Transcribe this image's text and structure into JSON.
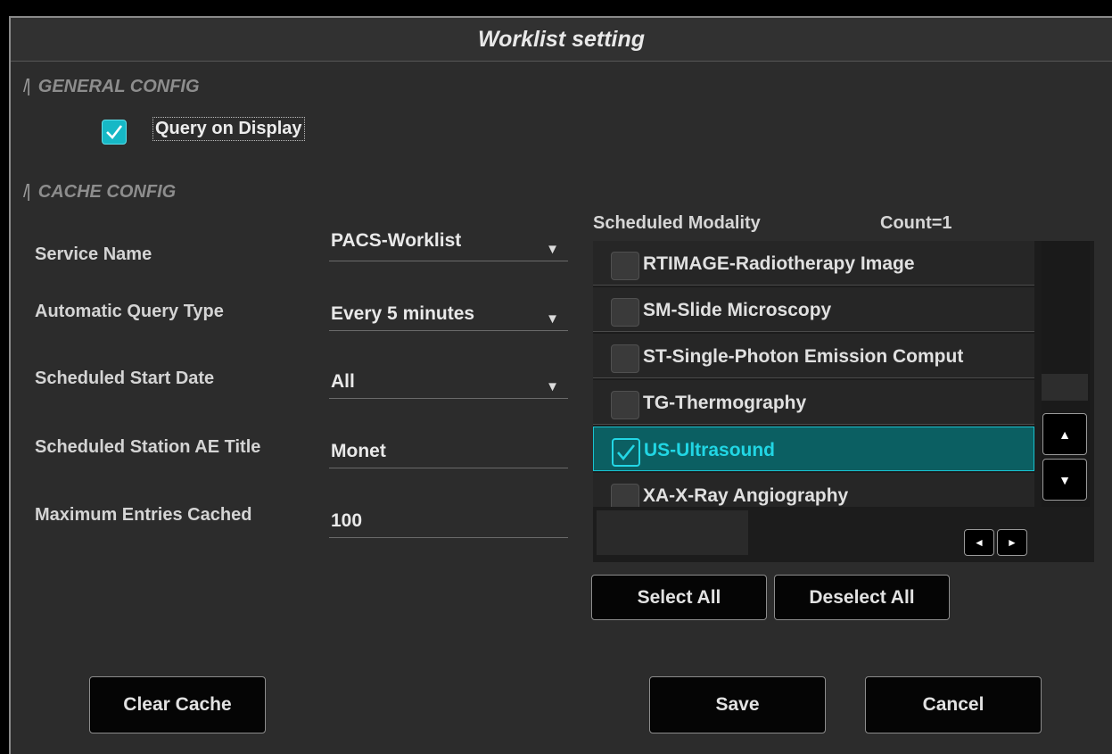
{
  "dialog": {
    "title": "Worklist setting"
  },
  "general": {
    "heading": "GENERAL CONFIG",
    "query_on_display": {
      "label": "Query on Display",
      "checked": true
    }
  },
  "cache": {
    "heading": "CACHE CONFIG",
    "fields": [
      {
        "label": "Service Name",
        "value": "PACS-Worklist",
        "type": "dropdown"
      },
      {
        "label": "Automatic Query Type",
        "value": "Every 5 minutes",
        "type": "dropdown"
      },
      {
        "label": "Scheduled Start Date",
        "value": "All",
        "type": "dropdown"
      },
      {
        "label": "Scheduled Station AE Title",
        "value": "Monet",
        "type": "text"
      },
      {
        "label": "Maximum Entries Cached",
        "value": "100",
        "type": "text"
      }
    ]
  },
  "modality": {
    "title": "Scheduled Modality",
    "count": "Count=1",
    "items": [
      {
        "label": "RTIMAGE-Radiotherapy Image",
        "checked": false
      },
      {
        "label": "SM-Slide Microscopy",
        "checked": false
      },
      {
        "label": "ST-Single-Photon Emission Comput",
        "checked": false
      },
      {
        "label": "TG-Thermography",
        "checked": false
      },
      {
        "label": "US-Ultrasound",
        "checked": true
      },
      {
        "label": "XA-X-Ray Angiography",
        "checked": false
      }
    ],
    "scroll": {
      "up": "▲",
      "down": "▼",
      "left": "◄",
      "right": "►"
    },
    "select_all": "Select All",
    "deselect_all": "Deselect All"
  },
  "buttons": {
    "clear_cache": "Clear Cache",
    "save": "Save",
    "cancel": "Cancel"
  },
  "colors": {
    "accent": "#16b8c6",
    "selected_row": "#0b5f62",
    "background": "#2c2c2c"
  }
}
